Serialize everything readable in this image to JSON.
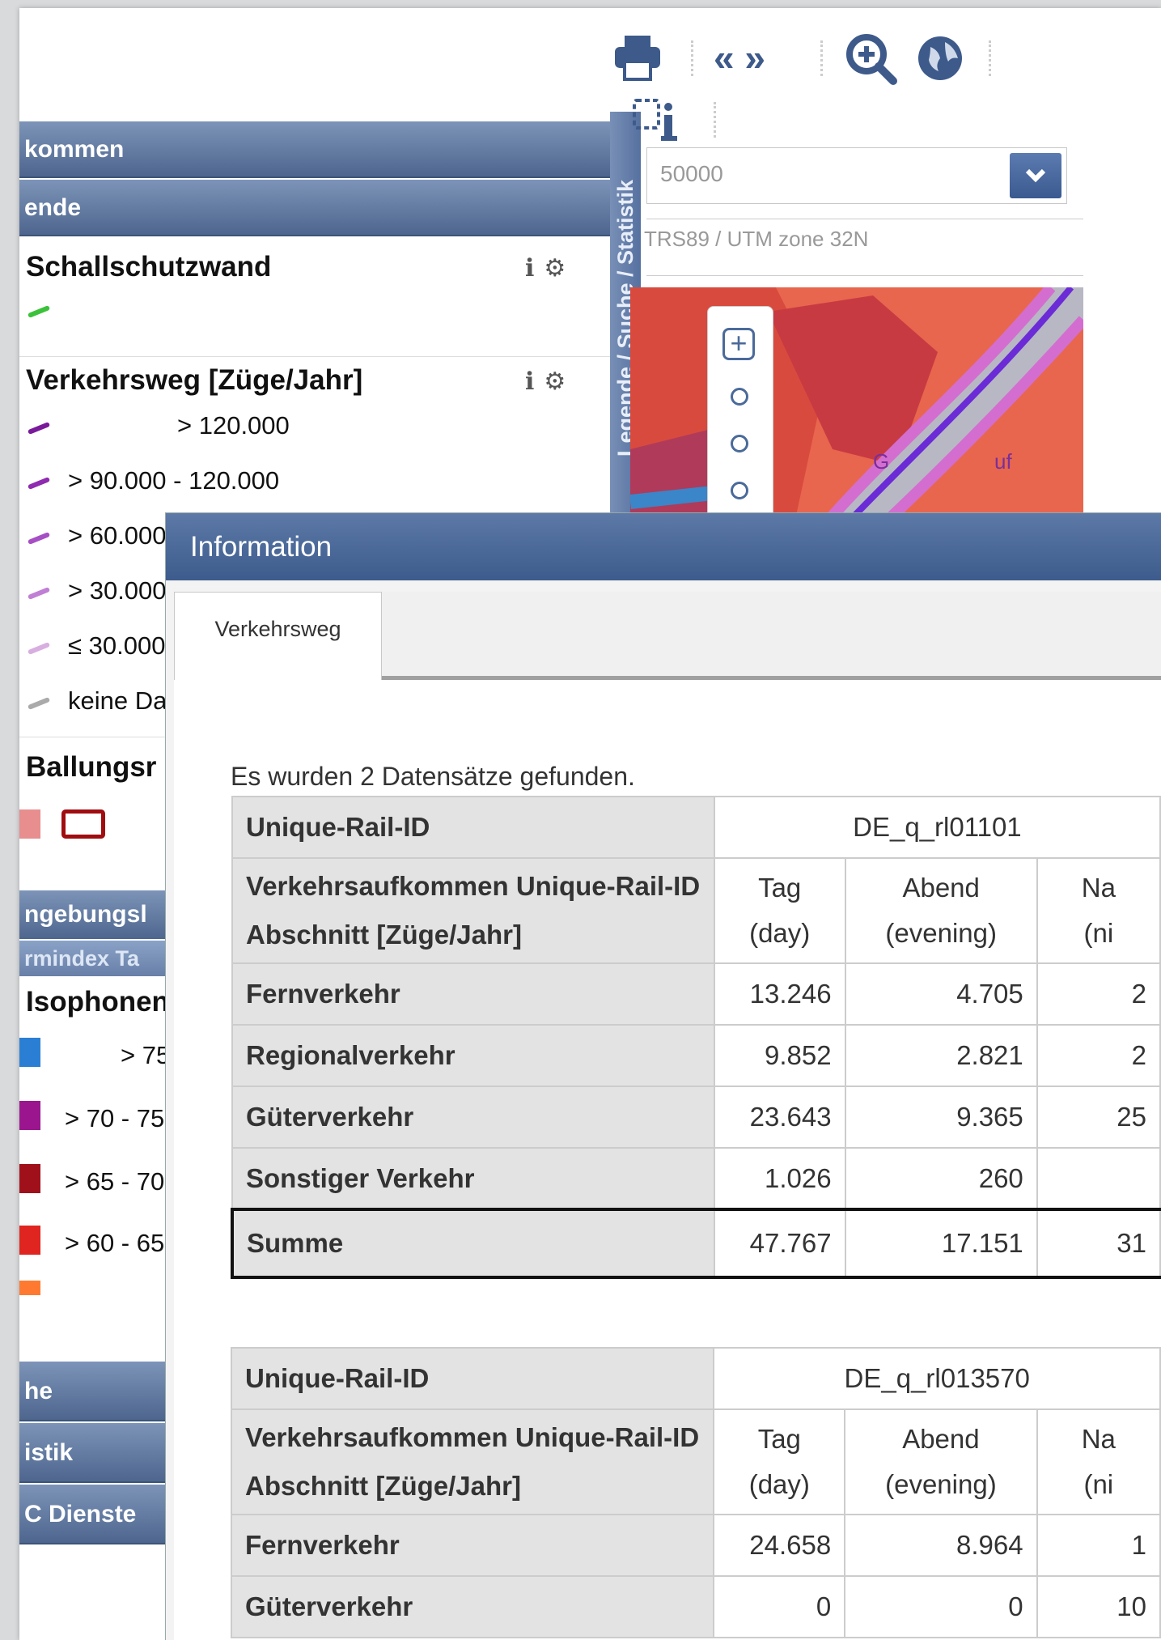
{
  "toolbar": {
    "print_icon": "printer-icon",
    "prev_next": "« »",
    "zoom_icon": "zoom-in-icon",
    "globe_icon": "globe-icon",
    "info_icon": "feature-info-icon"
  },
  "left_panel": {
    "headers": [
      "kommen",
      "ende"
    ],
    "vertical_tab_label": "Legende / Suche / Statistik",
    "legend": {
      "schallschutz_title": "Schallschutzwand",
      "verkehrsweg_title": "Verkehrsweg [Züge/Jahr]",
      "verkehrsweg_items": [
        "> 120.000",
        "> 90.000 - 120.000",
        "> 60.000",
        "> 30.000",
        "≤ 30.000",
        "keine Da"
      ],
      "ballungs_title": "Ballungsr",
      "sub_headers": [
        "ngebungsl",
        "rmindex Ta"
      ],
      "isophonen_title": "Isophonen",
      "isophonen_items": [
        "> 75",
        "> 70 - 75",
        "> 65 - 70",
        "> 60 - 65"
      ]
    },
    "bottom_headers": [
      "he",
      "istik",
      "C Dienste"
    ]
  },
  "map": {
    "scale_value": "50000",
    "crs": "TRS89 / UTM zone 32N",
    "place_label": "G",
    "place_label2": "uf"
  },
  "dialog": {
    "title": "Information",
    "tab_label": "Verkehrsweg",
    "found_text": "Es wurden 2 Datensätze gefunden.",
    "tables": [
      {
        "id_label": "Unique-Rail-ID",
        "id_value": "DE_q_rl01101",
        "header_label": "Verkehrsaufkommen Unique-Rail-ID Abschnitt [Züge/Jahr]",
        "col_headers": [
          "Tag (day)",
          "Abend (evening)",
          "Na (ni"
        ],
        "rows": [
          {
            "label": "Fernverkehr",
            "values": [
              "13.246",
              "4.705",
              "2"
            ]
          },
          {
            "label": "Regionalverkehr",
            "values": [
              "9.852",
              "2.821",
              "2"
            ]
          },
          {
            "label": "Güterverkehr",
            "values": [
              "23.643",
              "9.365",
              "25"
            ]
          },
          {
            "label": "Sonstiger Verkehr",
            "values": [
              "1.026",
              "260",
              ""
            ]
          }
        ],
        "sum": {
          "label": "Summe",
          "values": [
            "47.767",
            "17.151",
            "31"
          ]
        }
      },
      {
        "id_label": "Unique-Rail-ID",
        "id_value": "DE_q_rl013570",
        "header_label": "Verkehrsaufkommen Unique-Rail-ID Abschnitt [Züge/Jahr]",
        "col_headers": [
          "Tag (day)",
          "Abend (evening)",
          "Na (ni"
        ],
        "rows": [
          {
            "label": "Fernverkehr",
            "values": [
              "24.658",
              "8.964",
              "1"
            ]
          },
          {
            "label": "Güterverkehr",
            "values": [
              "0",
              "0",
              "10"
            ]
          }
        ]
      }
    ]
  },
  "colors": {
    "header_blue": "#4e668e",
    "verkehrsweg_lines": [
      "#7a1a9a",
      "#8e2bb0",
      "#a64fc4",
      "#c07fd4",
      "#d8aee0",
      "#aaaaaa"
    ],
    "isophonen": [
      "#2a7fd4",
      "#9b168e",
      "#a0101a",
      "#e0241f",
      "#ff7a30"
    ],
    "ballung_fill": "#e88e8e",
    "ballung_border": "#a00d10"
  }
}
